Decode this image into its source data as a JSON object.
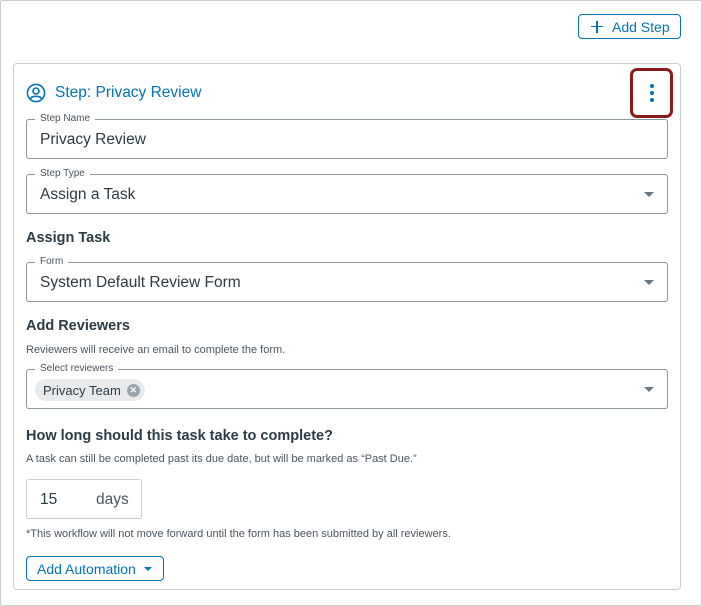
{
  "toolbar": {
    "add_step_label": "Add Step"
  },
  "step": {
    "title": "Step: Privacy Review",
    "name_field": {
      "label": "Step Name",
      "value": "Privacy Review"
    },
    "type_field": {
      "label": "Step Type",
      "value": "Assign a Task"
    }
  },
  "assign_task": {
    "heading": "Assign Task",
    "form_field": {
      "label": "Form",
      "value": "System Default Review Form"
    }
  },
  "reviewers": {
    "heading": "Add Reviewers",
    "helper": "Reviewers will receive an email to complete the form.",
    "field_label": "Select reviewers",
    "selected": [
      "Privacy Team"
    ]
  },
  "duration": {
    "heading": "How long should this task take to complete?",
    "helper": "A task can still be completed past its due date, but will be marked as “Past Due.”",
    "value": "15",
    "unit": "days",
    "note": "*This workflow will not move forward until the form has been submitted by all reviewers."
  },
  "automation": {
    "button_label": "Add Automation"
  },
  "colors": {
    "accent": "#0374b5",
    "highlight": "#8b1a1a",
    "text": "#2d3b45"
  },
  "icons": [
    "plus-icon",
    "user-circle-icon",
    "kebab-menu-icon",
    "chevron-down-icon",
    "remove-tag-icon",
    "caret-down-icon"
  ]
}
